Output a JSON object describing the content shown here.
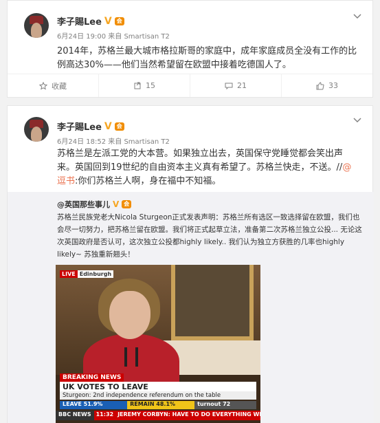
{
  "posts": [
    {
      "author": "李子賜Lee",
      "verified": "V",
      "vip": "会",
      "date": "6月24日 19:00",
      "source": "来自 Smartisan T2",
      "text": "2014年，苏格兰最大城市格拉斯哥的家庭中，成年家庭成员全没有工作的比例高达30%——他们当然希望留在欧盟中接着吃德国人了。",
      "actions": {
        "favorite": "收藏",
        "repost": "15",
        "comment": "21",
        "like": "33"
      }
    },
    {
      "author": "李子賜Lee",
      "verified": "V",
      "vip": "会",
      "date": "6月24日 18:52",
      "source": "来自 Smartisan T2",
      "text_main": "苏格兰是左派工党的大本营。如果独立出去，英国保守党睡觉都会笑出声来。英国回到19世纪的自由资本主义真有希望了。苏格兰快走，不送。//",
      "text_link": "@逗书",
      "text_tail": ":你们苏格兰人啊，身在福中不知福。",
      "repost": {
        "author": "@英国那些事儿",
        "text": "苏格兰民族党老大Nicola Sturgeon正式发表声明：苏格兰所有选区一致选择留在欧盟，我们也会尽一切努力，把苏格兰留在欧盟。我们将正式起草立法，准备第二次苏格兰独立公投... 无论这次英国政府是否认可，这次独立公投都highly likely.. 我们认为独立方获胜的几率也highly likely~ 苏独重新翘头！",
        "video": {
          "live": "LIVE",
          "location": "Edinburgh",
          "breaking": "BREAKING NEWS",
          "headline": "UK VOTES TO LEAVE",
          "subline": "Sturgeon: 2nd independence referendum on the table",
          "leave": "LEAVE 51.9%",
          "remain": "REMAIN 48.1%",
          "turnout": "turnout 72",
          "channel": "BBC NEWS",
          "time": "11:32",
          "ticker": "JEREMY CORBYN: HAVE TO DO EVERYTHING WE C"
        }
      }
    }
  ],
  "colors": {
    "link": "#eb7350",
    "accent": "#f6a623",
    "breaking": "#c00"
  }
}
